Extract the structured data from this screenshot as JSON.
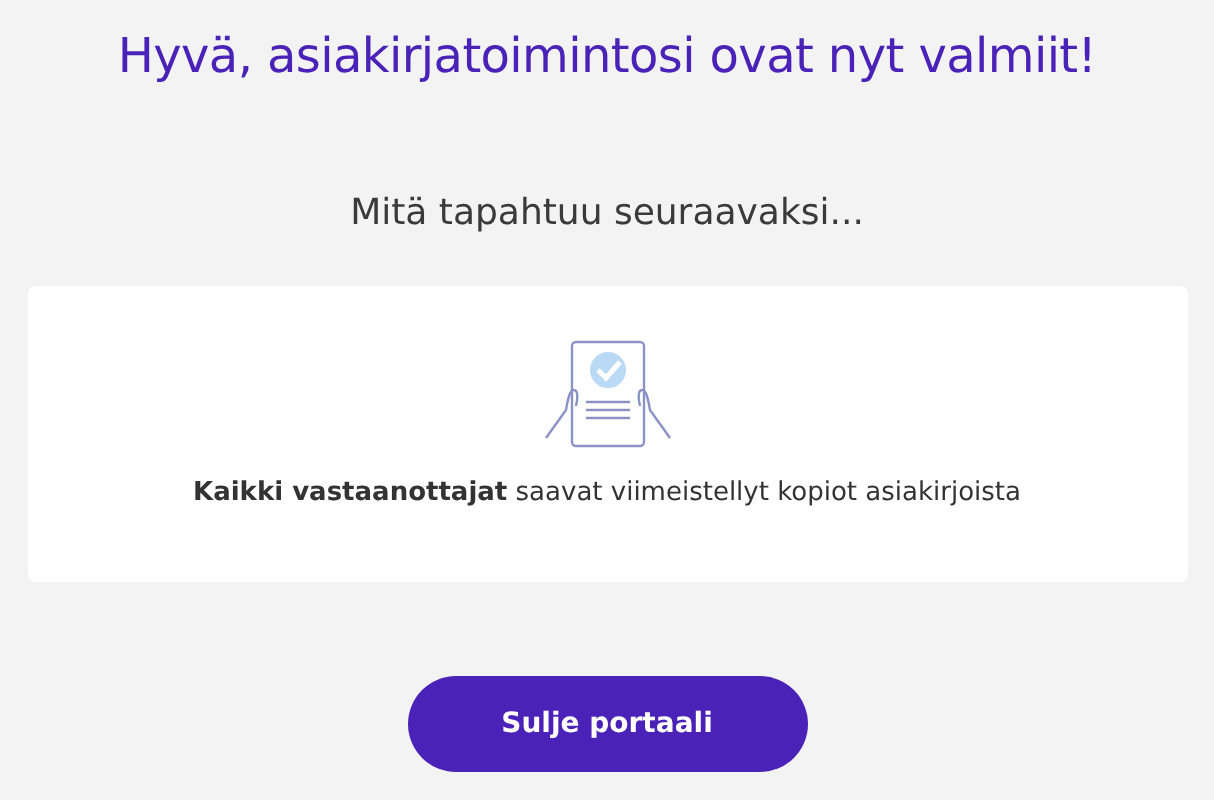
{
  "title": "Hyvä, asiakirjatoimintosi ovat nyt valmiit!",
  "subtitle": "Mitä tapahtuu seuraavaksi...",
  "card": {
    "message": "**Kaikki vastaanottajat** saavat viimeistellyt kopiot asiakirjoista"
  },
  "button": "Sulje portaali"
}
